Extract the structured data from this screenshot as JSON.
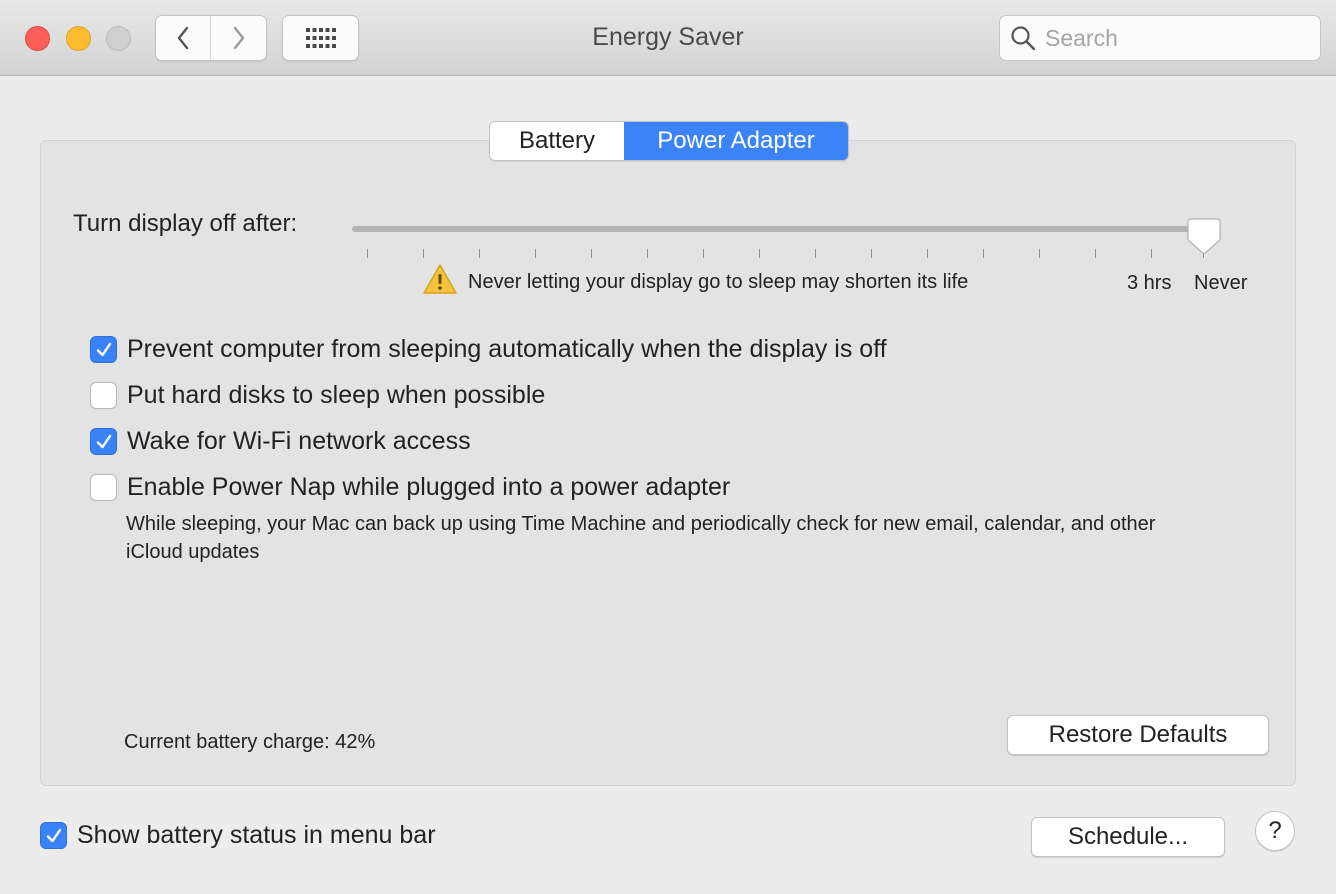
{
  "window": {
    "title": "Energy Saver"
  },
  "toolbar": {
    "back_icon": "chevron-left-icon",
    "forward_icon": "chevron-right-icon",
    "grid_icon": "grid-icon",
    "search_placeholder": "Search"
  },
  "tabs": [
    {
      "label": "Battery",
      "selected": false
    },
    {
      "label": "Power Adapter",
      "selected": true
    }
  ],
  "display_sleep": {
    "label": "Turn display off after:",
    "value": "Never",
    "warning_icon": "warning-icon",
    "warning_text": "Never letting your display go to sleep may shorten its life",
    "tick_label_3hrs": "3 hrs",
    "tick_label_never": "Never"
  },
  "options": [
    {
      "label": "Prevent computer from sleeping automatically when the display is off",
      "checked": true
    },
    {
      "label": "Put hard disks to sleep when possible",
      "checked": false
    },
    {
      "label": "Wake for Wi-Fi network access",
      "checked": true
    },
    {
      "label": "Enable Power Nap while plugged into a power adapter",
      "checked": false
    }
  ],
  "power_nap_description": "While sleeping, your Mac can back up using Time Machine and periodically check for new email, calendar, and other iCloud updates",
  "battery_charge": "Current battery charge: 42%",
  "buttons": {
    "restore": "Restore Defaults",
    "schedule": "Schedule...",
    "help": "?"
  },
  "show_battery_status": {
    "label": "Show battery status in menu bar",
    "checked": true
  },
  "colors": {
    "accent": "#3b83f7"
  }
}
